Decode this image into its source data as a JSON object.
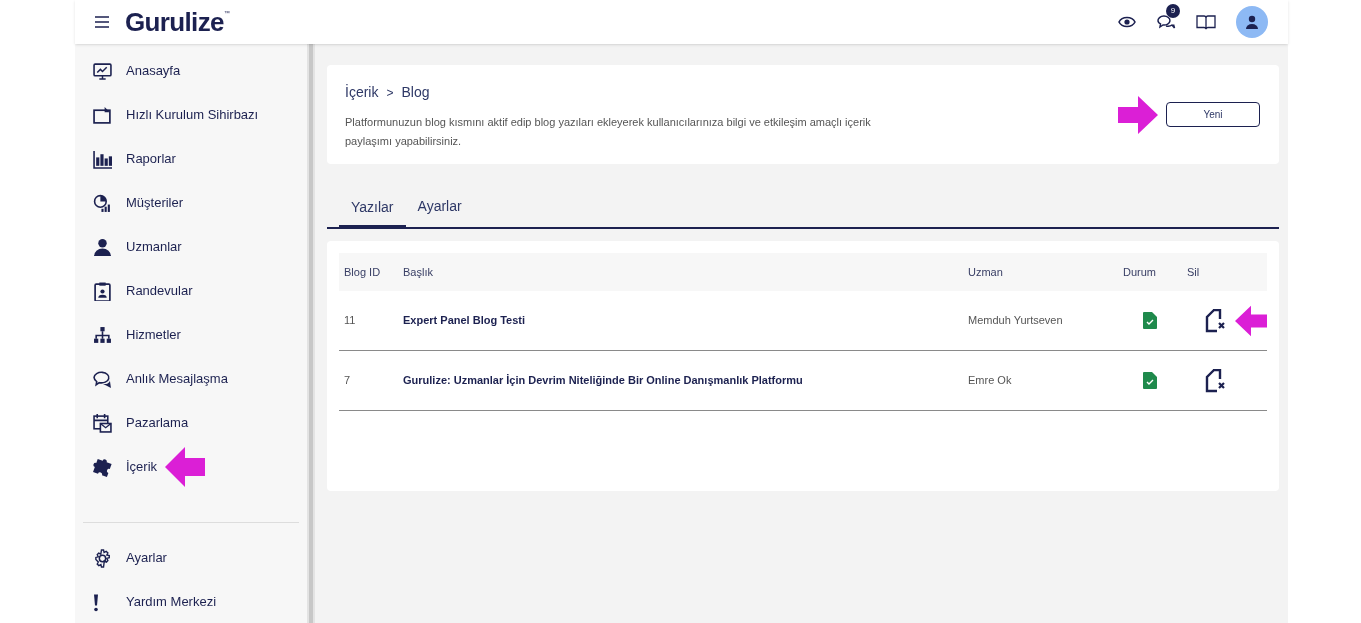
{
  "header": {
    "logo": "Gurulize",
    "logo_mark": "™",
    "message_count": "9"
  },
  "sidebar": {
    "items": [
      {
        "label": "Anasayfa"
      },
      {
        "label": "Hızlı Kurulum Sihirbazı"
      },
      {
        "label": "Raporlar"
      },
      {
        "label": "Müşteriler"
      },
      {
        "label": "Uzmanlar"
      },
      {
        "label": "Randevular"
      },
      {
        "label": "Hizmetler"
      },
      {
        "label": "Anlık Mesajlaşma"
      },
      {
        "label": "Pazarlama"
      },
      {
        "label": "İçerik"
      }
    ],
    "bottom_items": [
      {
        "label": "Ayarlar"
      },
      {
        "label": "Yardım Merkezi"
      }
    ]
  },
  "page": {
    "breadcrumb": [
      "İçerik",
      "Blog"
    ],
    "separator": ">",
    "description": "Platformunuzun blog kısmını aktif edip blog yazıları ekleyerek kullanıcılarınıza bilgi ve etkileşim amaçlı içerik paylaşımı yapabilirsiniz.",
    "new_button": "Yeni"
  },
  "tabs": [
    {
      "label": "Yazılar",
      "selected": true
    },
    {
      "label": "Ayarlar",
      "selected": false
    }
  ],
  "table": {
    "columns": [
      "Blog ID",
      "Başlık",
      "Uzman",
      "Durum",
      "Sil"
    ],
    "rows": [
      {
        "id": "11",
        "title": "Expert Panel Blog Testi",
        "expert": "Memduh Yurtseven",
        "published": true
      },
      {
        "id": "7",
        "title": "Gurulize: Uzmanlar İçin Devrim Niteliğinde Bir Online Danışmanlık Platformu",
        "expert": "Emre Ok",
        "published": true
      }
    ]
  }
}
